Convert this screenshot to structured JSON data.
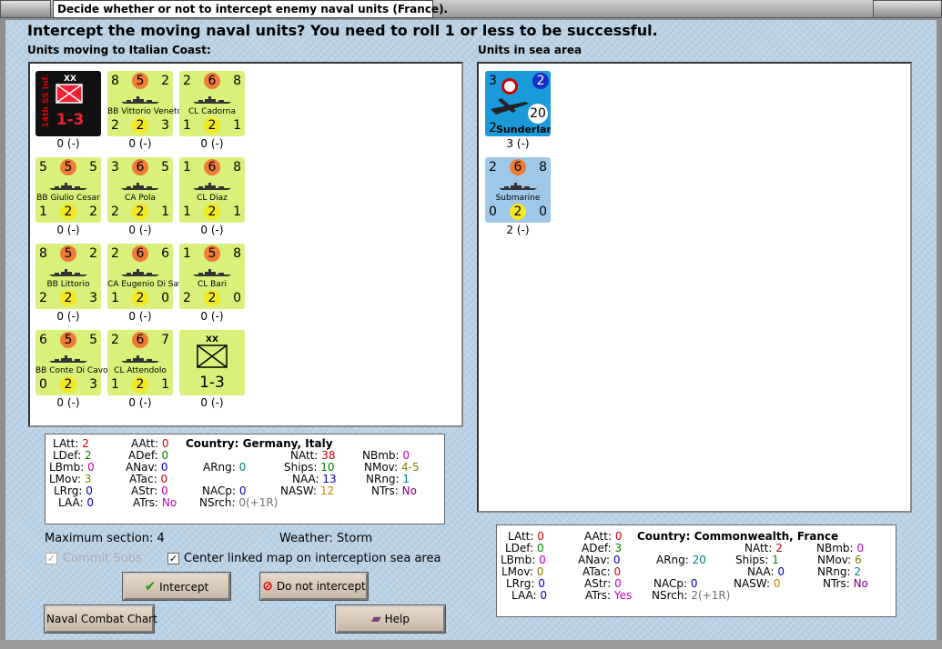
{
  "window": {
    "title": "Decide whether or not to intercept enemy naval units (France)."
  },
  "prompt": "Intercept the moving naval units?  You need to roll 1 or less to be successful.",
  "left_panel_label": "Units moving to Italian Coast:",
  "right_panel_label": "Units in sea area",
  "moving_units": [
    {
      "kind": "land",
      "name": "14th SS Inf.",
      "size": "XX",
      "value": "1-3",
      "under": "0 (-)"
    },
    {
      "kind": "ship",
      "name": "BB Vittorio Veneto",
      "tl": "8",
      "tc": "5",
      "tr": "2",
      "bl": "2",
      "bc": "2",
      "br": "3",
      "under": "0 (-)"
    },
    {
      "kind": "ship",
      "name": "CL Cadorna",
      "tl": "2",
      "tc": "6",
      "tr": "8",
      "bl": "1",
      "bc": "2",
      "br": "1",
      "under": "0 (-)"
    },
    {
      "kind": "ship",
      "name": "BB Giulio Cesar",
      "tl": "5",
      "tc": "5",
      "tr": "5",
      "bl": "1",
      "bc": "2",
      "br": "2",
      "under": "0 (-)"
    },
    {
      "kind": "ship",
      "name": "CA Pola",
      "tl": "3",
      "tc": "6",
      "tr": "5",
      "bl": "2",
      "bc": "2",
      "br": "1",
      "under": "0 (-)"
    },
    {
      "kind": "ship",
      "name": "CL Diaz",
      "tl": "1",
      "tc": "6",
      "tr": "8",
      "bl": "1",
      "bc": "2",
      "br": "1",
      "under": "0 (-)"
    },
    {
      "kind": "ship",
      "name": "BB Littorio",
      "tl": "8",
      "tc": "5",
      "tr": "2",
      "bl": "2",
      "bc": "2",
      "br": "3",
      "under": "0 (-)"
    },
    {
      "kind": "ship",
      "name": "CA Eugenio Di Savoia",
      "tl": "2",
      "tc": "6",
      "tr": "6",
      "bl": "1",
      "bc": "2",
      "br": "0",
      "under": "0 (-)"
    },
    {
      "kind": "ship",
      "name": "CL Bari",
      "tl": "1",
      "tc": "5",
      "tr": "8",
      "bl": "2",
      "bc": "2",
      "br": "0",
      "under": "0 (-)"
    },
    {
      "kind": "ship",
      "name": "BB Conte Di Cavour",
      "tl": "6",
      "tc": "5",
      "tr": "5",
      "bl": "0",
      "bc": "2",
      "br": "3",
      "under": "0 (-)"
    },
    {
      "kind": "ship",
      "name": "CL Attendolo",
      "tl": "2",
      "tc": "6",
      "tr": "7",
      "bl": "1",
      "bc": "2",
      "br": "1",
      "under": "0 (-)"
    },
    {
      "kind": "landplain",
      "size": "XX",
      "value": "1-3",
      "under": "0 (-)"
    }
  ],
  "sea_units": [
    {
      "kind": "air",
      "name": "Sunderland",
      "tl": "3",
      "tr": "2",
      "range": "20",
      "bl": "2",
      "under": "3 (-)"
    },
    {
      "kind": "ship",
      "name": "Submarine",
      "tl": "2",
      "tc": "6",
      "tr": "8",
      "bl": "0",
      "bc": "2",
      "br": "0",
      "under": "2 (-)"
    }
  ],
  "left_stats": {
    "country_label": "Country:",
    "country": "Germany, Italy",
    "LAtt": "2",
    "LDef": "2",
    "LBmb": "0",
    "LMov": "3",
    "LRg": "0",
    "LAA": "0",
    "AAtt": "0",
    "ADef": "0",
    "ANav": "0",
    "ATac": "0",
    "AStr": "0",
    "ATrs": "No",
    "ARng": "0",
    "NACp": "0",
    "NSrch": "0(+1R)",
    "NAtt": "38",
    "Ships": "10",
    "NAA": "13",
    "NASW": "12",
    "NBmb": "0",
    "NMov": "4-5",
    "NRng": "1",
    "NTrs": "No"
  },
  "right_stats": {
    "country_label": "Country:",
    "country": "Commonwealth, France",
    "LAtt": "0",
    "LDef": "0",
    "LBmb": "0",
    "LMov": "0",
    "LRg": "0",
    "LAA": "0",
    "AAtt": "0",
    "ADef": "3",
    "ANav": "0",
    "ATac": "0",
    "AStr": "0",
    "ATrs": "Yes",
    "ARng": "20",
    "NACp": "0",
    "NSrch": "2(+1R)",
    "NAtt": "2",
    "Ships": "1",
    "NAA": "0",
    "NASW": "0",
    "NBmb": "0",
    "NMov": "6",
    "NRng": "2",
    "NTrs": "No"
  },
  "max_section": "Maximum section: 4",
  "weather": "Weather:  Storm",
  "commit_subs": "Commit Subs",
  "center_map": "Center linked map on interception sea area",
  "buttons": {
    "intercept": "Intercept",
    "no_intercept": "Do not intercept",
    "naval_chart": "Naval Combat Chart",
    "help": "Help"
  },
  "colors": {
    "land_unit": "#d9f07a",
    "sea_unit": "#9fc8e8",
    "attack_circle": "#f07a3a",
    "defense_circle": "#f5e820",
    "background": "#b9d2e6"
  }
}
